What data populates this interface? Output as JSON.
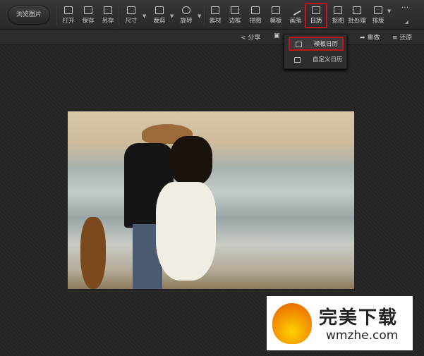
{
  "toolbar": {
    "browse_label": "浏览图片",
    "tools": [
      "打开",
      "保存",
      "另存",
      "尺寸",
      "裁剪",
      "旋转",
      "素材",
      "边框",
      "拼图",
      "模板",
      "画笔",
      "日历",
      "抠图",
      "批处理",
      "排版"
    ],
    "more": "···"
  },
  "subbar": {
    "share": "分享",
    "redo": "重做",
    "restore": "还原"
  },
  "calendar_menu": {
    "items": [
      "模板日历",
      "自定义日历"
    ]
  },
  "watermark": {
    "title": "完美下载",
    "url": "wmzhe.com"
  },
  "colors": {
    "highlight": "#c0141a",
    "background": "#262626"
  }
}
